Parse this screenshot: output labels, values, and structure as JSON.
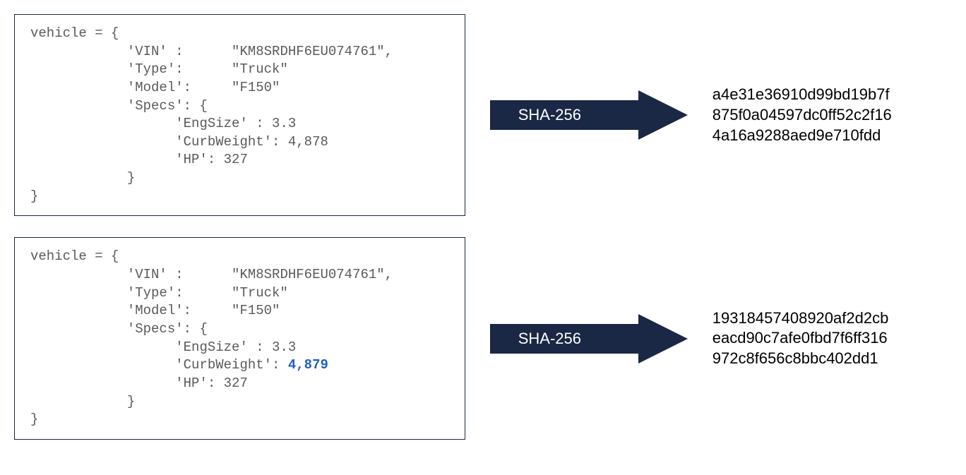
{
  "arrow_label": "SHA-256",
  "block1": {
    "line1": "vehicle = {",
    "line2": "            'VIN' :      \"KM8SRDHF6EU074761\",",
    "line3": "            'Type':      \"Truck\"",
    "line4": "            'Model':     \"F150\"",
    "line5": "            'Specs': {",
    "line6": "                  'EngSize' : 3.3",
    "line7": "                  'CurbWeight': 4,878",
    "line8": "                  'HP': 327",
    "line9": "            }",
    "line10": "}",
    "hash_l1": "a4e31e36910d99bd19b7f",
    "hash_l2": "875f0a04597dc0ff52c2f16",
    "hash_l3": "4a16a9288aed9e710fdd"
  },
  "block2": {
    "line1": "vehicle = {",
    "line2": "            'VIN' :      \"KM8SRDHF6EU074761\",",
    "line3": "            'Type':      \"Truck\"",
    "line4": "            'Model':     \"F150\"",
    "line5": "            'Specs': {",
    "line6": "                  'EngSize' : 3.3",
    "line7a": "                  'CurbWeight': ",
    "line7b": "4,879",
    "line8": "                  'HP': 327",
    "line9": "            }",
    "line10": "}",
    "hash_l1": "19318457408920af2d2cb",
    "hash_l2": "eacd90c7afe0fbd7f6ff316",
    "hash_l3": "972c8f656c8bbc402dd1"
  }
}
